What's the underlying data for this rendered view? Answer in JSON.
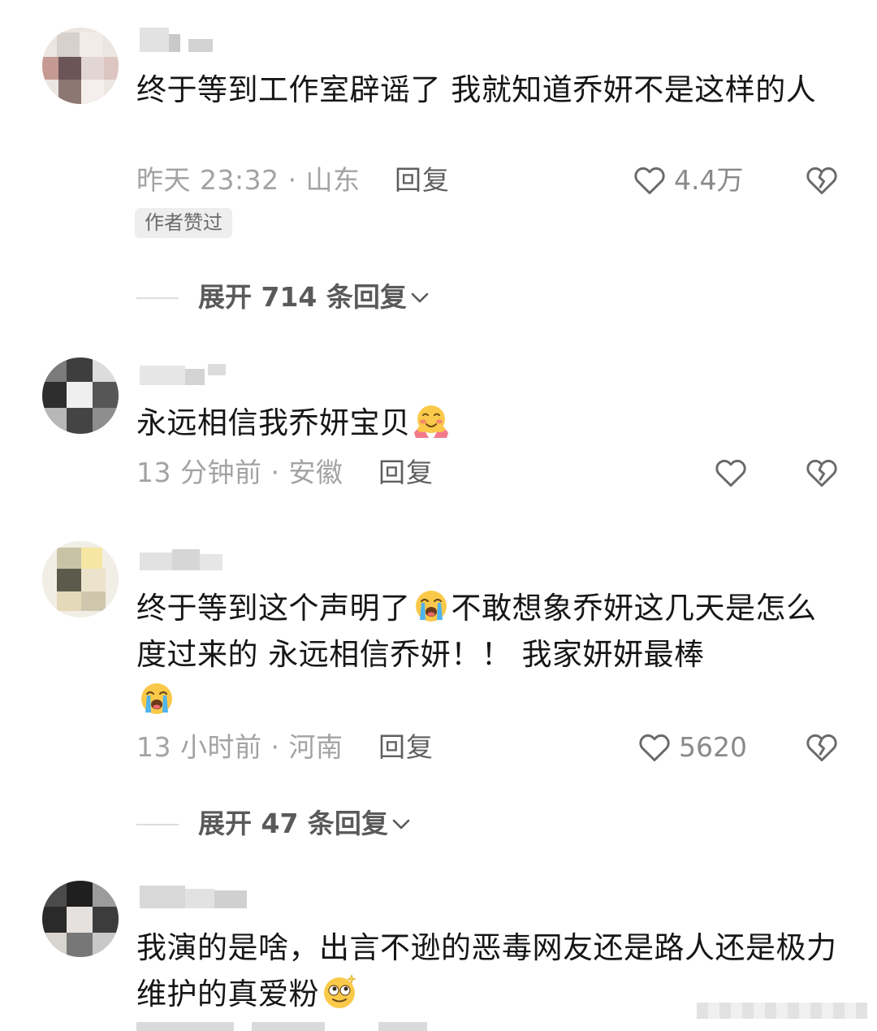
{
  "comments": [
    {
      "text": "终于等到工作室辟谣了  我就知道乔妍不是这样的人",
      "time_location": "昨天 23:32 · 山东",
      "reply_label": "回复",
      "like_count": "4.4万",
      "author_badge": "作者赞过",
      "expand_label": "展开 714 条回复"
    },
    {
      "text": "永远相信我乔妍宝贝",
      "emoji": "hugging-face",
      "time_location": "13 分钟前 · 安徽",
      "reply_label": "回复",
      "like_count": ""
    },
    {
      "text_part1": "终于等到这个声明了",
      "text_part2": "不敢想象乔妍这几天是怎么度过来的 永远相信乔妍！！ 我家妍妍最棒",
      "emoji": "loudly-crying-face",
      "time_location": "13 小时前 · 河南",
      "reply_label": "回复",
      "like_count": "5620",
      "expand_label": "展开 47 条回复"
    },
    {
      "text": "我演的是啥，出言不逊的恶毒网友还是路人还是极力维护的真爱粉",
      "emoji": "dizzy-face"
    }
  ],
  "icons": {
    "like": "heart-outline-icon",
    "dislike": "broken-heart-icon",
    "expand": "chevron-down-icon"
  },
  "colors": {
    "text_primary": "#161616",
    "text_meta": "#a3a3a3",
    "text_reply": "#5f5f5f",
    "badge_bg": "#eeeeee"
  }
}
